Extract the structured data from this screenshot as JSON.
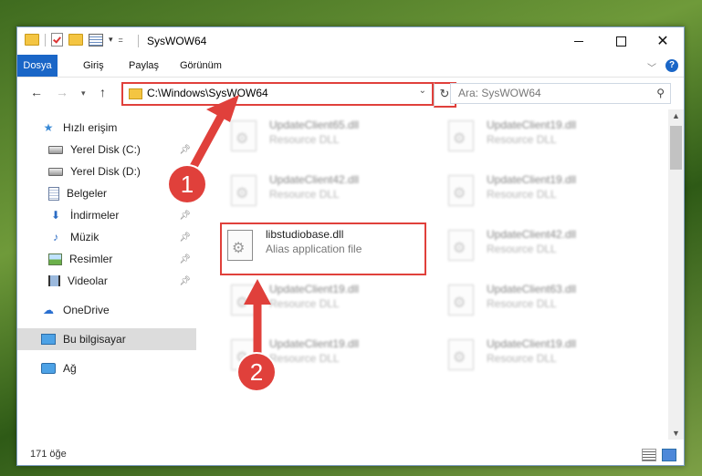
{
  "window": {
    "title": "SysWOW64",
    "controls": {
      "minimize": "",
      "maximize": "",
      "close": "✕"
    }
  },
  "ribbon": {
    "tabs": [
      {
        "label": "Dosya"
      },
      {
        "label": "Giriş"
      },
      {
        "label": "Paylaş"
      },
      {
        "label": "Görünüm"
      }
    ],
    "help": "?"
  },
  "navigation": {
    "address": "C:\\Windows\\SysWOW64",
    "search_placeholder": "Ara: SysWOW64"
  },
  "sidebar": {
    "items": [
      {
        "label": "Hızlı erişim",
        "icon": "star-icon"
      },
      {
        "label": "Yerel Disk (C:)",
        "icon": "drive-icon",
        "pinned": true
      },
      {
        "label": "Yerel Disk (D:)",
        "icon": "drive-icon",
        "pinned": true
      },
      {
        "label": "Belgeler",
        "icon": "documents-icon",
        "pinned": true
      },
      {
        "label": "İndirmeler",
        "icon": "download-icon",
        "pinned": true
      },
      {
        "label": "Müzik",
        "icon": "music-icon",
        "pinned": true
      },
      {
        "label": "Resimler",
        "icon": "pictures-icon",
        "pinned": true
      },
      {
        "label": "Videolar",
        "icon": "videos-icon",
        "pinned": true
      },
      {
        "label": "OneDrive",
        "icon": "cloud-icon"
      },
      {
        "label": "Bu bilgisayar",
        "icon": "computer-icon",
        "selected": true
      },
      {
        "label": "Ağ",
        "icon": "network-icon"
      }
    ]
  },
  "files": [
    {
      "name": "UpdateClient65.dll",
      "type": "Resource DLL"
    },
    {
      "name": "UpdateClient19.dll",
      "type": "Resource DLL"
    },
    {
      "name": "UpdateClient42.dll",
      "type": "Resource DLL"
    },
    {
      "name": "UpdateClient19.dll",
      "type": "Resource DLL"
    },
    {
      "name": "libstudiobase.dll",
      "type": "Alias application file"
    },
    {
      "name": "UpdateClient42.dll",
      "type": "Resource DLL"
    },
    {
      "name": "UpdateClient19.dll",
      "type": "Resource DLL"
    },
    {
      "name": "UpdateClient63.dll",
      "type": "Resource DLL"
    },
    {
      "name": "UpdateClient19.dll",
      "type": "Resource DLL"
    },
    {
      "name": "UpdateClient19.dll",
      "type": "Resource DLL"
    }
  ],
  "status": {
    "count": "171 öğe"
  },
  "annotations": {
    "step1": "1",
    "step2": "2",
    "color": "#e0403b"
  }
}
